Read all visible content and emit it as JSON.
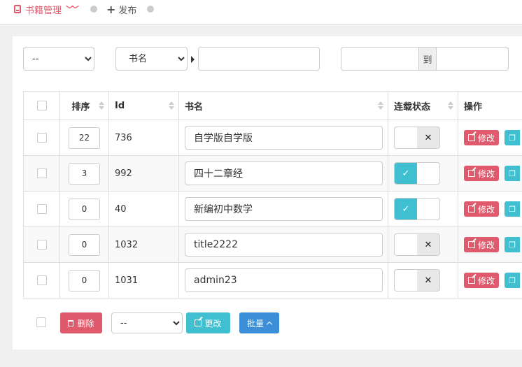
{
  "tabs": {
    "books_label": "书籍管理",
    "publish_label": "发布"
  },
  "filters": {
    "select_value": "--",
    "field_select_value": "书名",
    "search_value": "",
    "range_from": "",
    "range_sep": "到",
    "range_to": ""
  },
  "table": {
    "headers": {
      "sort": "排序",
      "id": "Id",
      "name": "书名",
      "status": "连载状态",
      "action": "操作"
    },
    "edit_label": "修改",
    "rows": [
      {
        "sort": "22",
        "id": "736",
        "name": "自学版自学版",
        "serial": false
      },
      {
        "sort": "3",
        "id": "992",
        "name": "四十二章经",
        "serial": true
      },
      {
        "sort": "0",
        "id": "40",
        "name": "新编初中数学",
        "serial": true
      },
      {
        "sort": "0",
        "id": "1032",
        "name": "title2222",
        "serial": false
      },
      {
        "sort": "0",
        "id": "1031",
        "name": "admin23",
        "serial": false
      }
    ]
  },
  "footer": {
    "delete_label": "删除",
    "select_value": "--",
    "update_label": "更改",
    "batch_label": "批量"
  },
  "colors": {
    "danger": "#e05a6d",
    "info": "#3fbfd0",
    "primary": "#3a8fd8"
  }
}
